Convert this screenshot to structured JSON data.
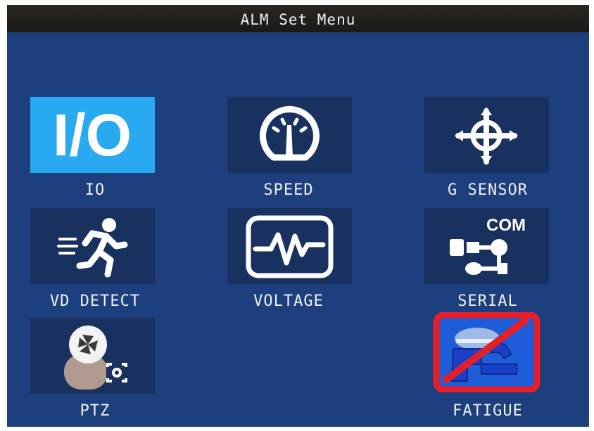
{
  "window": {
    "title": "ALM Set Menu"
  },
  "menu_items": [
    {
      "label": "IO",
      "icon": "io-icon",
      "selected": true
    },
    {
      "label": "SPEED",
      "icon": "speedometer-icon"
    },
    {
      "label": "G SENSOR",
      "icon": "crosshair-icon"
    },
    {
      "label": "VD DETECT",
      "icon": "running-person-icon"
    },
    {
      "label": "VOLTAGE",
      "icon": "voltage-waveform-icon"
    },
    {
      "label": "SERIAL",
      "icon": "serial-com-icon",
      "icon_text": "COM"
    },
    {
      "label": "PTZ",
      "icon": "ptz-camera-icon"
    },
    {
      "label": "FATIGUE",
      "icon": "fatigue-driver-icon"
    }
  ],
  "colors": {
    "screen_bg": "#1d3f7d",
    "tile_bg": "#18315e",
    "selected_bg": "#29a9ef",
    "title_bar": "#221f1c",
    "fatigue_red": "#e51f2a"
  }
}
